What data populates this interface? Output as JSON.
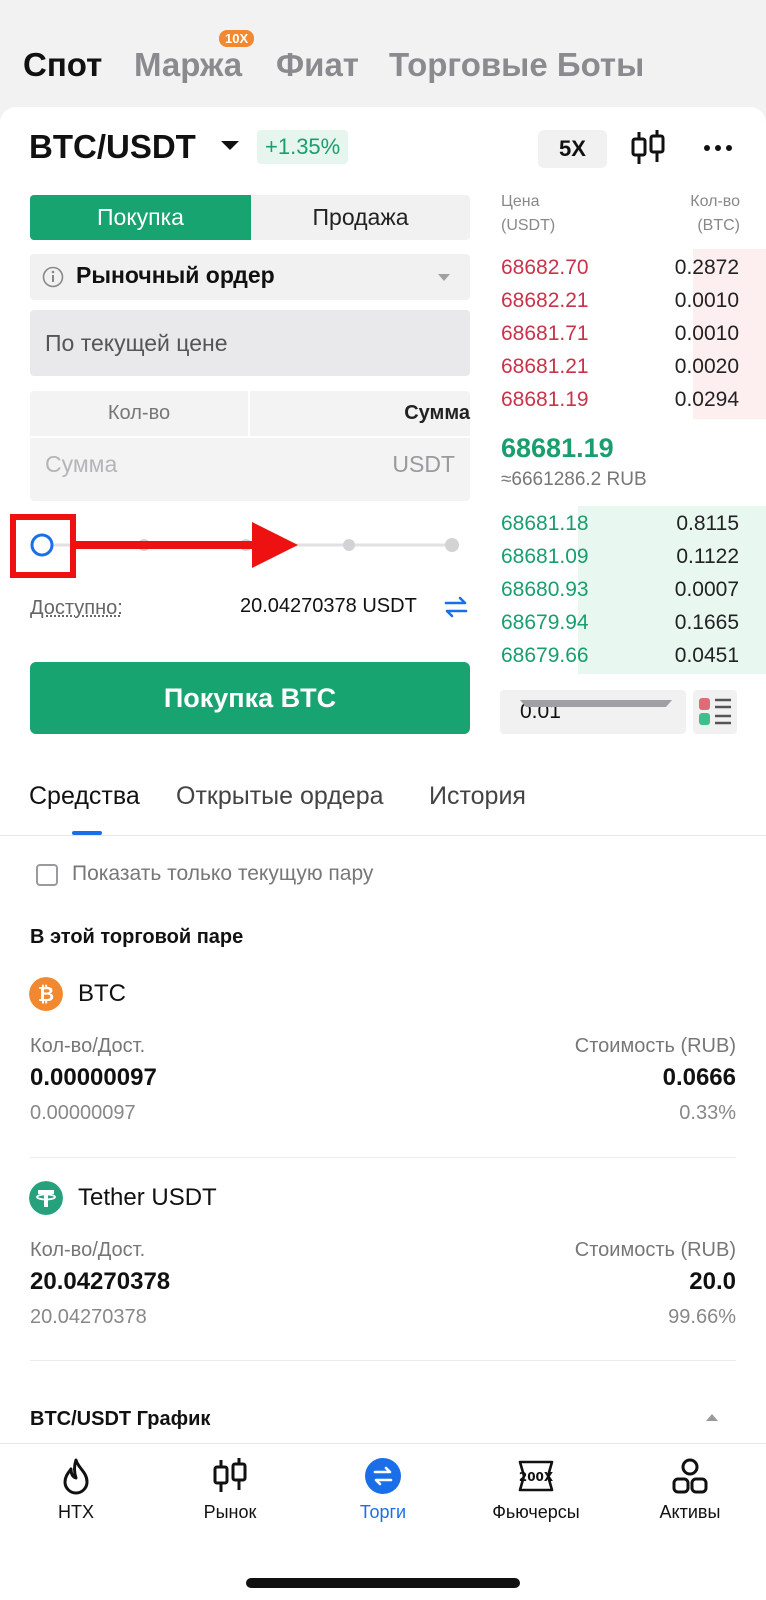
{
  "top_tabs": {
    "spot": "Спот",
    "margin": "Маржа",
    "margin_badge": "10X",
    "fiat": "Фиат",
    "bots": "Торговые Боты"
  },
  "header": {
    "pair": "BTC/USDT",
    "change": "+1.35%",
    "leverage": "5X",
    "icons": [
      "kline-icon",
      "more-icon"
    ]
  },
  "order_form": {
    "buy_tab": "Покупка",
    "sell_tab": "Продажа",
    "order_type": "Рыночный ордер",
    "price_placeholder": "По текущей цене",
    "qty_tab": "Кол-во",
    "sum_tab": "Сумма",
    "amount_placeholder": "Сумма",
    "amount_unit": "USDT",
    "slider_percent": 0,
    "available_label": "Доступно:",
    "available_value": "20.04270378 USDT",
    "submit": "Покупка  BTC"
  },
  "order_book": {
    "price_header": "Цена",
    "price_unit": "(USDT)",
    "qty_header": "Кол-во",
    "qty_unit": "(BTC)",
    "asks": [
      {
        "price": "68682.70",
        "qty": "0.2872"
      },
      {
        "price": "68682.21",
        "qty": "0.0010"
      },
      {
        "price": "68681.71",
        "qty": "0.0010"
      },
      {
        "price": "68681.21",
        "qty": "0.0020"
      },
      {
        "price": "68681.19",
        "qty": "0.0294"
      }
    ],
    "last_price": "68681.19",
    "last_price_rub": "≈6661286.2 RUB",
    "bids": [
      {
        "price": "68681.18",
        "qty": "0.8115"
      },
      {
        "price": "68681.09",
        "qty": "0.1122"
      },
      {
        "price": "68680.93",
        "qty": "0.0007"
      },
      {
        "price": "68679.94",
        "qty": "0.1665"
      },
      {
        "price": "68679.66",
        "qty": "0.0451"
      }
    ],
    "depth": "0.01"
  },
  "sub_tabs": {
    "funds": "Средства",
    "open_orders": "Открытые ордера",
    "history": "История"
  },
  "funds": {
    "checkbox_label": "Показать только текущую пару",
    "section_title": "В этой торговой паре",
    "assets": [
      {
        "name": "BTC",
        "qty_label": "Кол-во/Дост.",
        "qty": "0.00000097",
        "avail": "0.00000097",
        "value_label": "Стоимость (RUB)",
        "value": "0.0666",
        "share": "0.33%",
        "color": "#f2882f"
      },
      {
        "name": "Tether USDT",
        "qty_label": "Кол-во/Дост.",
        "qty": "20.04270378",
        "avail": "20.04270378",
        "value_label": "Стоимость (RUB)",
        "value": "20.0",
        "share": "99.66%",
        "color": "#26a17b"
      }
    ],
    "chart_title": "BTC/USDT График"
  },
  "bottom_nav": {
    "htx": "HTX",
    "market": "Рынок",
    "trade": "Торги",
    "futures": "Фьючерсы",
    "assets": "Активы",
    "futures_icon_text": "200X"
  },
  "colors": {
    "buy": "#17a471",
    "sell": "#c9334a",
    "accent": "#1a6fe8",
    "annotation": "#ee1111"
  }
}
